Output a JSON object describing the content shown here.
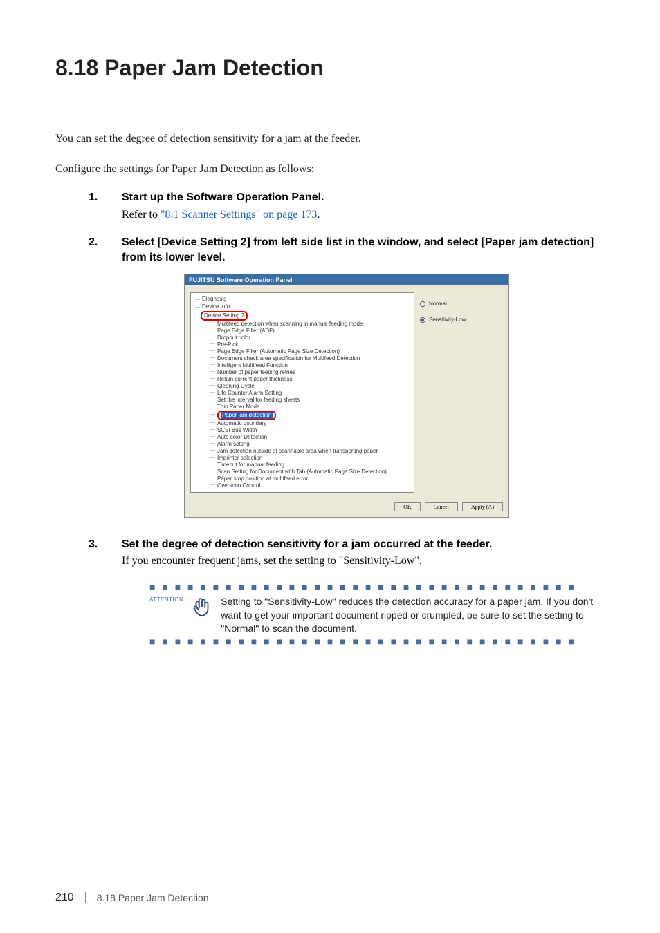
{
  "title": "8.18 Paper Jam Detection",
  "intro1": "You can set the degree of detection sensitivity for a jam at the feeder.",
  "intro2": "Configure the settings for Paper Jam Detection as follows:",
  "steps": {
    "s1_num": "1.",
    "s1_head": "Start up the Software Operation Panel.",
    "s1_body_pre": "Refer to ",
    "s1_body_link": "\"8.1 Scanner Settings\" on page 173",
    "s1_body_post": ".",
    "s2_num": "2.",
    "s2_head": "Select [Device Setting 2] from left side list in the window, and select [Paper jam detection] from its lower level.",
    "s3_num": "3.",
    "s3_head": "Set the degree of detection sensitivity for a jam occurred at the feeder.",
    "s3_body": "If you encounter frequent jams, set the setting to \"Sensitivity-Low\"."
  },
  "screenshot": {
    "title": "FUJITSU Software Operation Panel",
    "tree": {
      "diagnosis": "Diagnosis",
      "deviceinfo": "Device Info",
      "devicesetting2": "Device Setting 2",
      "items": [
        "Multifeed detection when scanning in manual feeding mode",
        "Page Edge Filler (ADF)",
        "Dropout color",
        "Pre-Pick",
        "Page Edge Filler (Automatic Page Size Detection)",
        "Document check area specification for Multifeed Detection",
        "Intelligent Multifeed Function",
        "Number of paper feeding retries",
        "Retain current paper thickness",
        "Cleaning Cycle",
        "Life Counter Alarm Setting",
        "Set the interval for feeding sheets",
        "Thin Paper Mode"
      ],
      "highlighted": "Paper jam detection",
      "items2": [
        "Automatic boundary",
        "SCSI Bus Width",
        "Auto color Detection",
        "Alarm setting",
        "Jam detection outside of scannable area when transporting paper",
        "Imprinter selection",
        "Timeout for manual feeding",
        "Scan Setting for Document with Tab (Automatic Page Size Detection)",
        "Paper stop position at multifeed error",
        "Overscan Control"
      ]
    },
    "radio": {
      "normal": "Normal",
      "low": "Sensitivity-Low"
    },
    "buttons": {
      "ok": "OK",
      "cancel": "Cancel",
      "apply": "Apply (A)"
    }
  },
  "attention": {
    "label": "ATTENTION",
    "text": "Setting to \"Sensitivity-Low\" reduces the detection accuracy for a paper jam. If you don't want to get your important document ripped or crumpled, be sure to set the setting to \"Normal\" to scan the document."
  },
  "footer": {
    "page": "210",
    "section": "8.18 Paper Jam Detection"
  }
}
